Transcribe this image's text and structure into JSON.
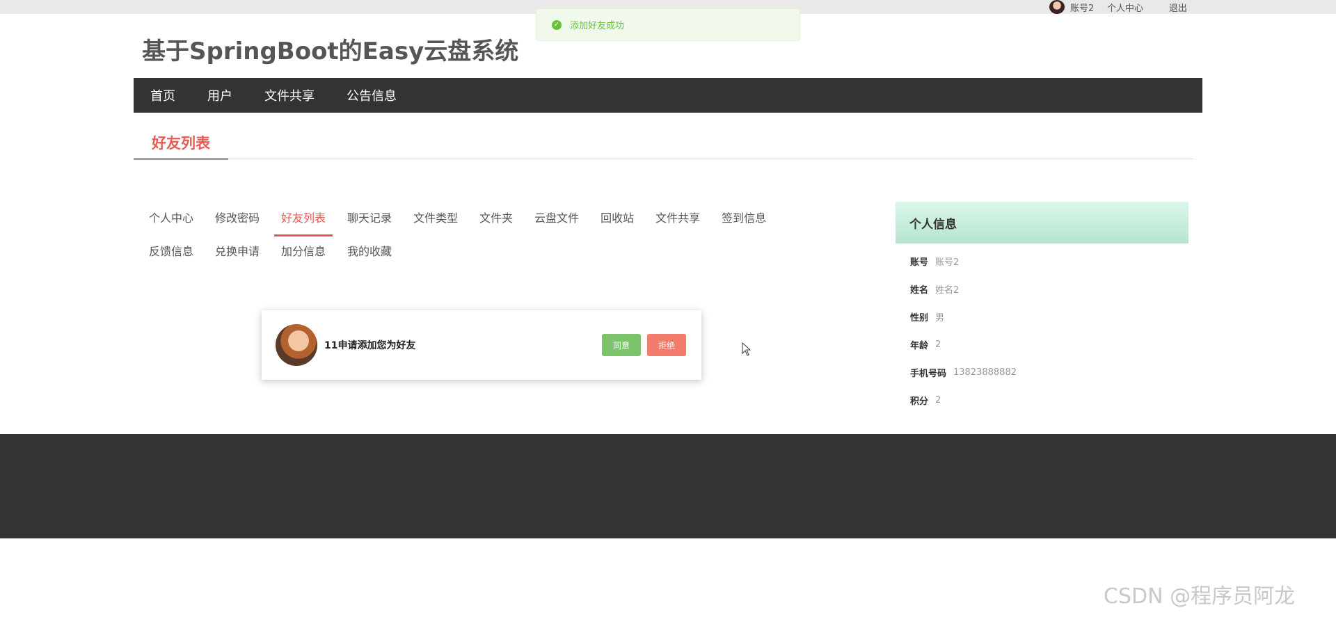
{
  "topbar": {
    "account": "账号2",
    "personal_center": "个人中心",
    "logout": "退出"
  },
  "toast": {
    "message": "添加好友成功"
  },
  "site_title": "基于SpringBoot的Easy云盘系统",
  "nav": {
    "items": [
      {
        "label": "首页"
      },
      {
        "label": "用户"
      },
      {
        "label": "文件共享"
      },
      {
        "label": "公告信息"
      }
    ]
  },
  "section_tab": "好友列表",
  "submenu": {
    "row1": [
      {
        "label": "个人中心"
      },
      {
        "label": "修改密码"
      },
      {
        "label": "好友列表"
      },
      {
        "label": "聊天记录"
      },
      {
        "label": "文件类型"
      },
      {
        "label": "文件夹"
      },
      {
        "label": "云盘文件"
      },
      {
        "label": "回收站"
      },
      {
        "label": "文件共享"
      },
      {
        "label": "签到信息"
      }
    ],
    "row2": [
      {
        "label": "反馈信息"
      },
      {
        "label": "兑换申请"
      },
      {
        "label": "加分信息"
      },
      {
        "label": "我的收藏"
      }
    ],
    "active": "好友列表"
  },
  "friend_request": {
    "text": "11申请添加您为好友",
    "agree_label": "同意",
    "reject_label": "拒绝"
  },
  "personal_info": {
    "title": "个人信息",
    "rows": [
      {
        "label": "账号",
        "value": "账号2"
      },
      {
        "label": "姓名",
        "value": "姓名2"
      },
      {
        "label": "性别",
        "value": "男"
      },
      {
        "label": "年龄",
        "value": "2"
      },
      {
        "label": "手机号码",
        "value": "13823888882"
      },
      {
        "label": "积分",
        "value": "2"
      }
    ]
  },
  "watermark": "CSDN @程序员阿龙",
  "colors": {
    "accent": "#e85b55",
    "nav_bg": "#333333",
    "success": "#67c23a",
    "agree": "#7dc36b",
    "reject": "#f27c6c",
    "panel_head": "#c8eedc"
  },
  "icons": {
    "toast": "check-circle-icon",
    "cursor": "mouse-pointer-icon"
  }
}
